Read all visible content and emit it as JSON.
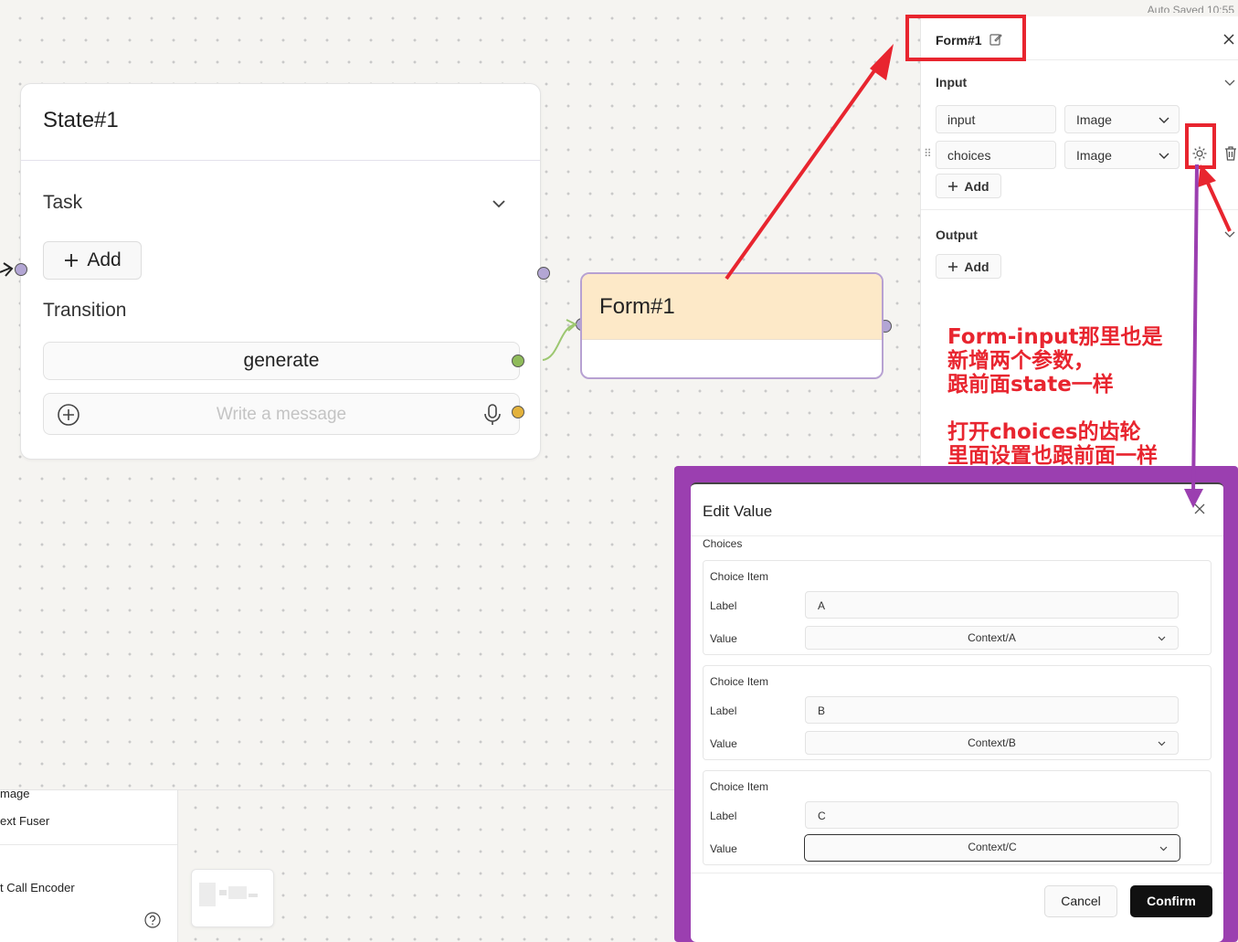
{
  "autosave": "Auto Saved 10:55",
  "state_node": {
    "title": "State#1",
    "task_label": "Task",
    "add_label": "Add",
    "transition_label": "Transition",
    "generate_label": "generate",
    "message_placeholder": "Write a message"
  },
  "form_node": {
    "title": "Form#1"
  },
  "side_panel": {
    "title": "Form#1",
    "input_section": "Input",
    "output_section": "Output",
    "inputs": [
      {
        "name": "input",
        "type": "Image"
      },
      {
        "name": "choices",
        "type": "Image"
      }
    ],
    "add_label": "Add"
  },
  "annotation": "Form-input那里也是\n新增两个参数，\n跟前面state一样\n\n打开choices的齿轮\n里面设置也跟前面一样",
  "bottom_panel": {
    "items": [
      "mage",
      "ext Fuser",
      "t Call Encoder"
    ]
  },
  "modal": {
    "title": "Edit Value",
    "choices_label": "Choices",
    "item_title": "Choice Item",
    "label_key": "Label",
    "value_key": "Value",
    "items": [
      {
        "label": "A",
        "value": "Context/A"
      },
      {
        "label": "B",
        "value": "Context/B"
      },
      {
        "label": "C",
        "value": "Context/C"
      }
    ],
    "cancel_label": "Cancel",
    "confirm_label": "Confirm"
  },
  "colors": {
    "annotation_red": "#e8252f",
    "frame_purple": "#9b3fb0",
    "form_header": "#fde9c8",
    "port_purple": "#b3a6d4",
    "port_green": "#8fbb5a",
    "port_orange": "#e3b23c"
  }
}
